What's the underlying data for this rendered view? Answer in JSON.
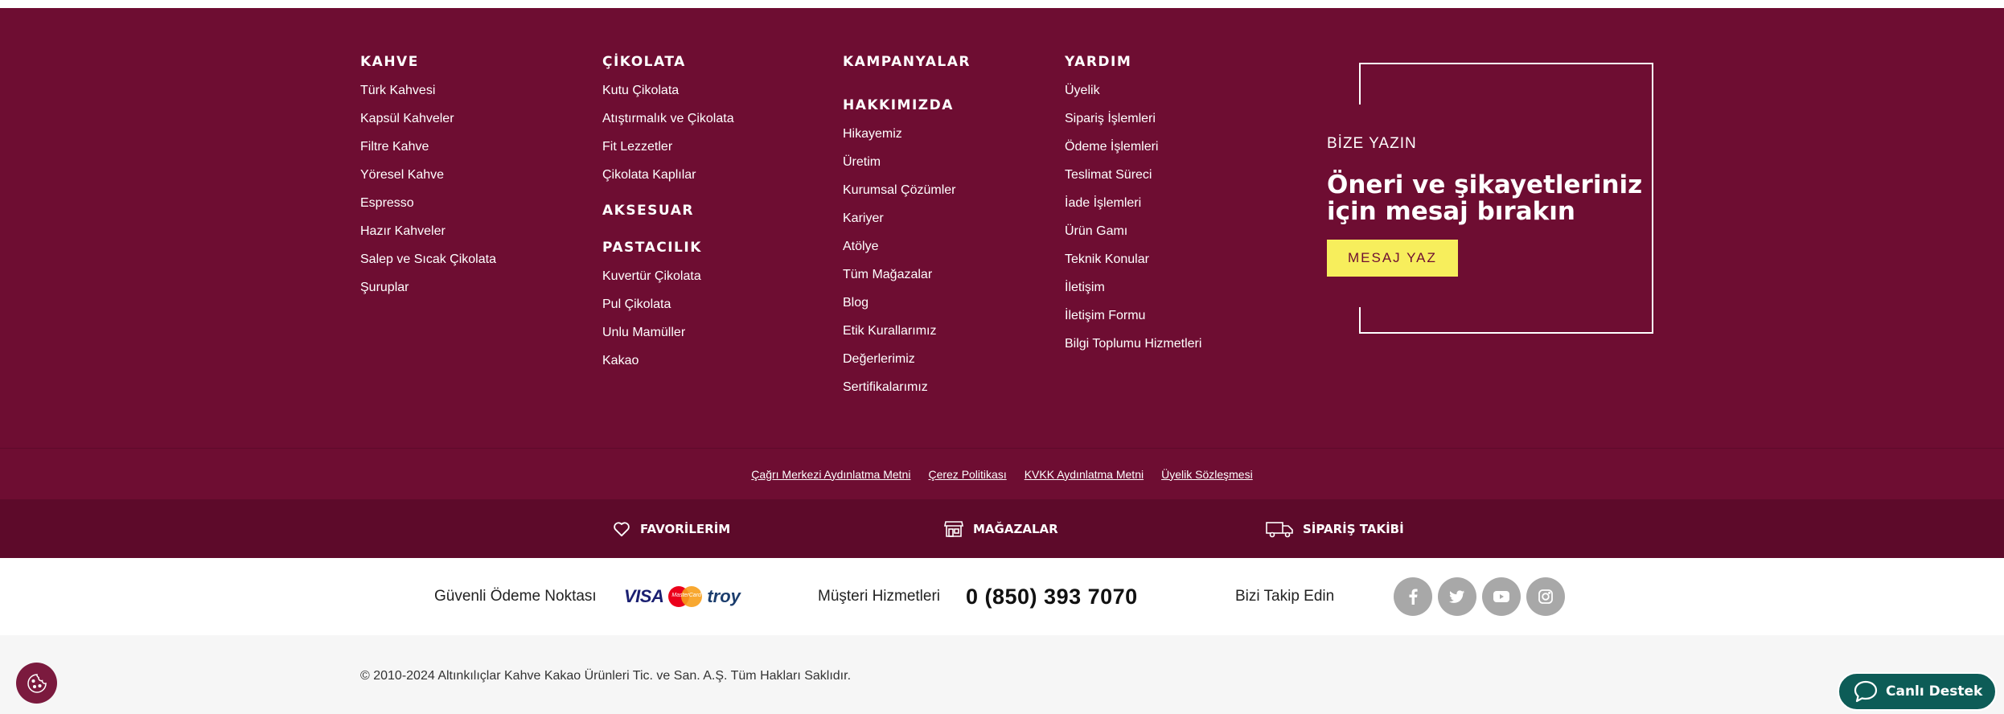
{
  "columns": {
    "kahve": {
      "title": "KAHVE",
      "items": [
        "Türk Kahvesi",
        "Kapsül Kahveler",
        "Filtre Kahve",
        "Yöresel Kahve",
        "Espresso",
        "Hazır Kahveler",
        "Salep ve Sıcak Çikolata",
        "Şuruplar"
      ]
    },
    "cikolata": {
      "title": "ÇİKOLATA",
      "items": [
        "Kutu Çikolata",
        "Atıştırmalık ve Çikolata",
        "Fit Lezzetler",
        "Çikolata Kaplılar"
      ],
      "aksesuar_title": "AKSESUAR",
      "pastacilik_title": "PASTACILIK",
      "pastacilik_items": [
        "Kuvertür Çikolata",
        "Pul Çikolata",
        "Unlu Mamüller",
        "Kakao"
      ]
    },
    "kampanyalar": {
      "title": "KAMPANYALAR",
      "hakkimizda_title": "HAKKIMIZDA",
      "hakkimizda_items": [
        "Hikayemiz",
        "Üretim",
        "Kurumsal Çözümler",
        "Kariyer",
        "Atölye",
        "Tüm Mağazalar",
        "Blog",
        "Etik Kurallarımız",
        "Değerlerimiz",
        "Sertifikalarımız"
      ]
    },
    "yardim": {
      "title": "YARDIM",
      "items": [
        "Üyelik",
        "Sipariş İşlemleri",
        "Ödeme İşlemleri",
        "Teslimat Süreci",
        "İade İşlemleri",
        "Ürün Gamı",
        "Teknik Konular",
        "İletişim",
        "İletişim Formu",
        "Bilgi Toplumu Hizmetleri"
      ]
    }
  },
  "contact": {
    "label": "BİZE YAZIN",
    "heading": "Öneri ve şikayetleriniz için mesaj bırakın",
    "button": "MESAJ YAZ"
  },
  "legal_links": [
    "Çağrı Merkezi Aydınlatma Metni",
    "Çerez Politikası",
    "KVKK Aydınlatma Metni",
    "Üyelik Sözleşmesi"
  ],
  "icon_bar": {
    "favorites": "FAVORİLERİM",
    "stores": "MAĞAZALAR",
    "order_tracking": "SİPARİŞ TAKİBİ"
  },
  "info_bar": {
    "payment_label": "Güvenli Ödeme Noktası",
    "payment_logos": {
      "visa": "VISA",
      "mastercard": "MasterCard",
      "troy": "troy"
    },
    "service_label": "Müşteri Hizmetleri",
    "phone": "0 (850) 393 7070",
    "follow_label": "Bizi Takip Edin",
    "socials": [
      "facebook-icon",
      "twitter-icon",
      "youtube-icon",
      "instagram-icon"
    ]
  },
  "copyright": "© 2010-2024 Altınkılıçlar Kahve Kakao Ürünleri Tic. ve San. A.Ş. Tüm Hakları Saklıdır.",
  "live_support": "Canlı Destek",
  "colors": {
    "brand": "#6e0d32",
    "brand_dark": "#5d0a2a",
    "cta_yellow": "#f7ee5c",
    "support_teal": "#0d5c57",
    "social_grey": "#a8a8a8"
  }
}
